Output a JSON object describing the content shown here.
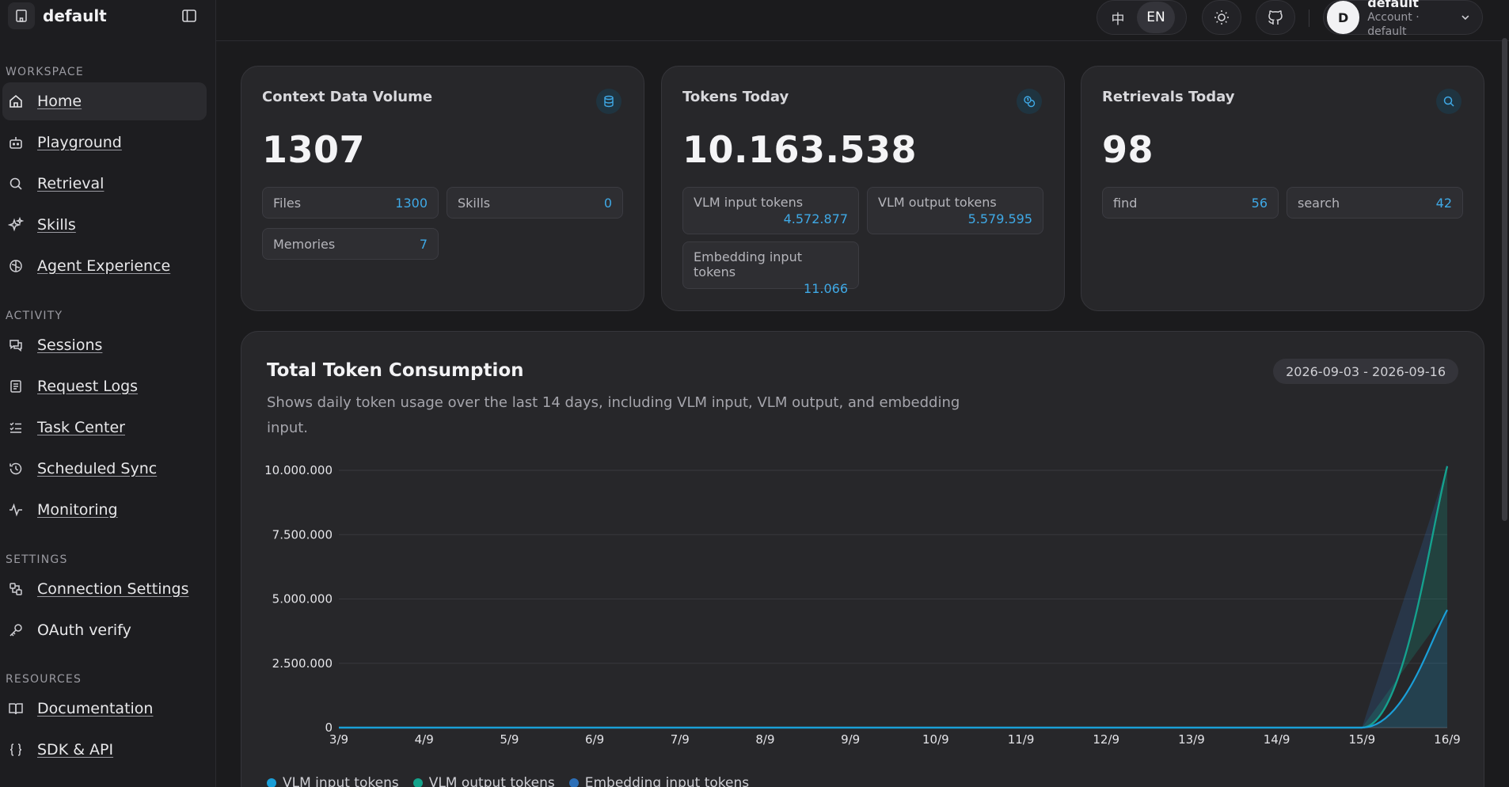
{
  "brand": {
    "name": "default"
  },
  "sidebar": {
    "sections": {
      "workspace": "WORKSPACE",
      "activity": "ACTIVITY",
      "settings": "SETTINGS",
      "resources": "RESOURCES"
    },
    "items": [
      {
        "label": "Home",
        "icon": "home-icon",
        "active": true
      },
      {
        "label": "Playground",
        "icon": "robot-icon"
      },
      {
        "label": "Retrieval",
        "icon": "search-icon"
      },
      {
        "label": "Skills",
        "icon": "sparkles-icon"
      },
      {
        "label": "Agent Experience",
        "icon": "brain-icon"
      },
      {
        "label": "Sessions",
        "icon": "chat-icon"
      },
      {
        "label": "Request Logs",
        "icon": "logs-icon"
      },
      {
        "label": "Task Center",
        "icon": "task-list-icon"
      },
      {
        "label": "Scheduled Sync",
        "icon": "history-icon"
      },
      {
        "label": "Monitoring",
        "icon": "activity-icon"
      },
      {
        "label": "Connection Settings",
        "icon": "plug-icon"
      },
      {
        "label": "OAuth verify",
        "icon": "key-icon"
      },
      {
        "label": "Documentation",
        "icon": "book-icon"
      },
      {
        "label": "SDK & API",
        "icon": "braces-icon"
      }
    ]
  },
  "topbar": {
    "lang_zh": "中",
    "lang_en": "EN",
    "account": {
      "initial": "D",
      "name": "default",
      "sub": "Account · default"
    }
  },
  "cards": {
    "context": {
      "title": "Context Data Volume",
      "value": "1307",
      "stats": [
        {
          "label": "Files",
          "value": "1300"
        },
        {
          "label": "Skills",
          "value": "0"
        },
        {
          "label": "Memories",
          "value": "7"
        }
      ]
    },
    "tokens": {
      "title": "Tokens Today",
      "value": "10.163.538",
      "stats": [
        {
          "label": "VLM input tokens",
          "value": "4.572.877"
        },
        {
          "label": "VLM output tokens",
          "value": "5.579.595"
        },
        {
          "label": "Embedding input tokens",
          "value": "11.066"
        }
      ]
    },
    "retrievals": {
      "title": "Retrievals Today",
      "value": "98",
      "stats": [
        {
          "label": "find",
          "value": "56"
        },
        {
          "label": "search",
          "value": "42"
        }
      ]
    }
  },
  "chart_section": {
    "title": "Total Token Consumption",
    "description": "Shows daily token usage over the last 14 days, including VLM input, VLM output, and embedding input.",
    "date_range": "2026-09-03 - 2026-09-16"
  },
  "colors": {
    "vlm_input": "#1a9fd8",
    "vlm_output": "#14a38b",
    "embedding": "#2d6fb7",
    "accent": "#3fa9e6"
  },
  "chart_data": {
    "type": "area",
    "stacked": true,
    "categories": [
      "3/9",
      "4/9",
      "5/9",
      "6/9",
      "7/9",
      "8/9",
      "9/9",
      "10/9",
      "11/9",
      "12/9",
      "13/9",
      "14/9",
      "15/9",
      "16/9"
    ],
    "series": [
      {
        "name": "VLM input tokens",
        "values": [
          0,
          0,
          0,
          0,
          0,
          0,
          0,
          0,
          0,
          0,
          0,
          0,
          0,
          4572877
        ]
      },
      {
        "name": "VLM output tokens",
        "values": [
          0,
          0,
          0,
          0,
          0,
          0,
          0,
          0,
          0,
          0,
          0,
          0,
          0,
          5579595
        ]
      },
      {
        "name": "Embedding input tokens",
        "values": [
          0,
          0,
          0,
          0,
          0,
          0,
          0,
          0,
          0,
          0,
          0,
          0,
          0,
          11066
        ]
      }
    ],
    "ylim": [
      0,
      10000000
    ],
    "yticks": [
      "0",
      "2.500.000",
      "5.000.000",
      "7.500.000",
      "10.000.000"
    ],
    "grid": true,
    "legend": "bottom-left"
  }
}
